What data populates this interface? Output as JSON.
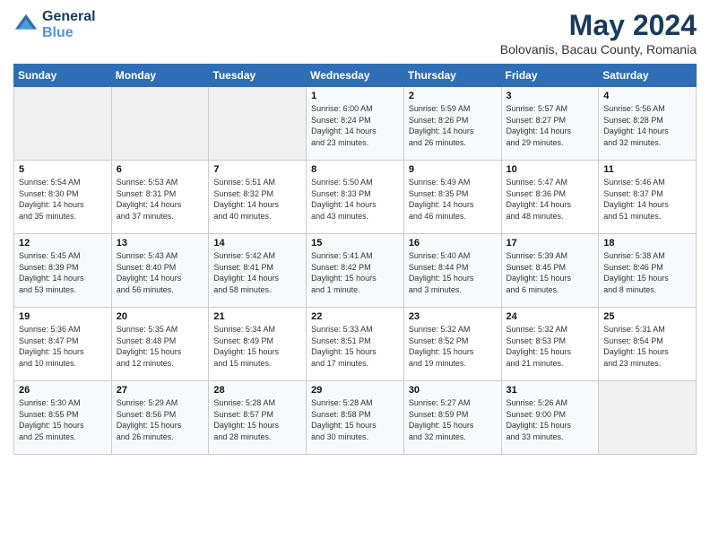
{
  "header": {
    "logo_line1": "General",
    "logo_line2": "Blue",
    "main_title": "May 2024",
    "subtitle": "Bolovanis, Bacau County, Romania"
  },
  "days_of_week": [
    "Sunday",
    "Monday",
    "Tuesday",
    "Wednesday",
    "Thursday",
    "Friday",
    "Saturday"
  ],
  "weeks": [
    [
      {
        "day": "",
        "text": ""
      },
      {
        "day": "",
        "text": ""
      },
      {
        "day": "",
        "text": ""
      },
      {
        "day": "1",
        "text": "Sunrise: 6:00 AM\nSunset: 8:24 PM\nDaylight: 14 hours\nand 23 minutes."
      },
      {
        "day": "2",
        "text": "Sunrise: 5:59 AM\nSunset: 8:26 PM\nDaylight: 14 hours\nand 26 minutes."
      },
      {
        "day": "3",
        "text": "Sunrise: 5:57 AM\nSunset: 8:27 PM\nDaylight: 14 hours\nand 29 minutes."
      },
      {
        "day": "4",
        "text": "Sunrise: 5:56 AM\nSunset: 8:28 PM\nDaylight: 14 hours\nand 32 minutes."
      }
    ],
    [
      {
        "day": "5",
        "text": "Sunrise: 5:54 AM\nSunset: 8:30 PM\nDaylight: 14 hours\nand 35 minutes."
      },
      {
        "day": "6",
        "text": "Sunrise: 5:53 AM\nSunset: 8:31 PM\nDaylight: 14 hours\nand 37 minutes."
      },
      {
        "day": "7",
        "text": "Sunrise: 5:51 AM\nSunset: 8:32 PM\nDaylight: 14 hours\nand 40 minutes."
      },
      {
        "day": "8",
        "text": "Sunrise: 5:50 AM\nSunset: 8:33 PM\nDaylight: 14 hours\nand 43 minutes."
      },
      {
        "day": "9",
        "text": "Sunrise: 5:49 AM\nSunset: 8:35 PM\nDaylight: 14 hours\nand 46 minutes."
      },
      {
        "day": "10",
        "text": "Sunrise: 5:47 AM\nSunset: 8:36 PM\nDaylight: 14 hours\nand 48 minutes."
      },
      {
        "day": "11",
        "text": "Sunrise: 5:46 AM\nSunset: 8:37 PM\nDaylight: 14 hours\nand 51 minutes."
      }
    ],
    [
      {
        "day": "12",
        "text": "Sunrise: 5:45 AM\nSunset: 8:39 PM\nDaylight: 14 hours\nand 53 minutes."
      },
      {
        "day": "13",
        "text": "Sunrise: 5:43 AM\nSunset: 8:40 PM\nDaylight: 14 hours\nand 56 minutes."
      },
      {
        "day": "14",
        "text": "Sunrise: 5:42 AM\nSunset: 8:41 PM\nDaylight: 14 hours\nand 58 minutes."
      },
      {
        "day": "15",
        "text": "Sunrise: 5:41 AM\nSunset: 8:42 PM\nDaylight: 15 hours\nand 1 minute."
      },
      {
        "day": "16",
        "text": "Sunrise: 5:40 AM\nSunset: 8:44 PM\nDaylight: 15 hours\nand 3 minutes."
      },
      {
        "day": "17",
        "text": "Sunrise: 5:39 AM\nSunset: 8:45 PM\nDaylight: 15 hours\nand 6 minutes."
      },
      {
        "day": "18",
        "text": "Sunrise: 5:38 AM\nSunset: 8:46 PM\nDaylight: 15 hours\nand 8 minutes."
      }
    ],
    [
      {
        "day": "19",
        "text": "Sunrise: 5:36 AM\nSunset: 8:47 PM\nDaylight: 15 hours\nand 10 minutes."
      },
      {
        "day": "20",
        "text": "Sunrise: 5:35 AM\nSunset: 8:48 PM\nDaylight: 15 hours\nand 12 minutes."
      },
      {
        "day": "21",
        "text": "Sunrise: 5:34 AM\nSunset: 8:49 PM\nDaylight: 15 hours\nand 15 minutes."
      },
      {
        "day": "22",
        "text": "Sunrise: 5:33 AM\nSunset: 8:51 PM\nDaylight: 15 hours\nand 17 minutes."
      },
      {
        "day": "23",
        "text": "Sunrise: 5:32 AM\nSunset: 8:52 PM\nDaylight: 15 hours\nand 19 minutes."
      },
      {
        "day": "24",
        "text": "Sunrise: 5:32 AM\nSunset: 8:53 PM\nDaylight: 15 hours\nand 21 minutes."
      },
      {
        "day": "25",
        "text": "Sunrise: 5:31 AM\nSunset: 8:54 PM\nDaylight: 15 hours\nand 23 minutes."
      }
    ],
    [
      {
        "day": "26",
        "text": "Sunrise: 5:30 AM\nSunset: 8:55 PM\nDaylight: 15 hours\nand 25 minutes."
      },
      {
        "day": "27",
        "text": "Sunrise: 5:29 AM\nSunset: 8:56 PM\nDaylight: 15 hours\nand 26 minutes."
      },
      {
        "day": "28",
        "text": "Sunrise: 5:28 AM\nSunset: 8:57 PM\nDaylight: 15 hours\nand 28 minutes."
      },
      {
        "day": "29",
        "text": "Sunrise: 5:28 AM\nSunset: 8:58 PM\nDaylight: 15 hours\nand 30 minutes."
      },
      {
        "day": "30",
        "text": "Sunrise: 5:27 AM\nSunset: 8:59 PM\nDaylight: 15 hours\nand 32 minutes."
      },
      {
        "day": "31",
        "text": "Sunrise: 5:26 AM\nSunset: 9:00 PM\nDaylight: 15 hours\nand 33 minutes."
      },
      {
        "day": "",
        "text": ""
      }
    ]
  ]
}
